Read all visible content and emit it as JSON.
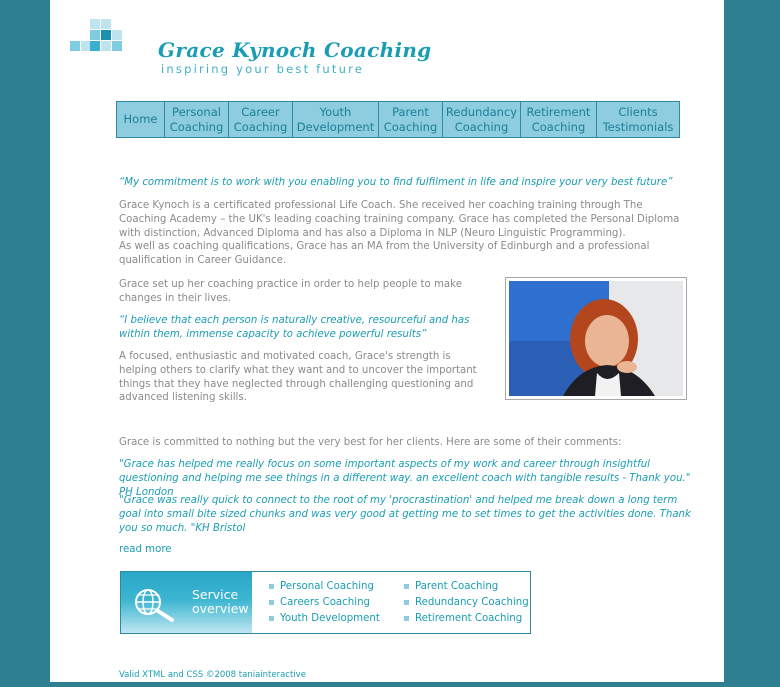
{
  "brand": {
    "name": "Grace Kynoch Coaching",
    "tagline": "inspiring your best future"
  },
  "nav": {
    "items": [
      {
        "label": "Home"
      },
      {
        "label": "Personal\nCoaching"
      },
      {
        "label": "Career\nCoaching"
      },
      {
        "label": "Youth\nDevelopment"
      },
      {
        "label": "Parent\nCoaching"
      },
      {
        "label": "Redundancy\nCoaching"
      },
      {
        "label": "Retirement\nCoaching"
      },
      {
        "label": "Clients\nTestimonials"
      }
    ]
  },
  "content": {
    "mission_quote": "“My commitment is to work with you enabling you to find fulfilment in life and inspire your very best future”",
    "intro_p1": "Grace Kynoch is a certificated professional Life Coach. She received her coaching training through The Coaching Academy – the UK's leading coaching training company. Grace has completed the Personal Diploma with distinction, Advanced Diploma and has also a Diploma in NLP (Neuro Linguistic Programming).",
    "intro_p2": "As well as coaching qualifications, Grace has an MA from the University of Edinburgh and a professional qualification in Career Guidance.",
    "setup_text": "Grace set up her coaching practice in order to help people to make changes in their lives.",
    "belief_quote": "“I believe that each person is naturally creative, resourceful and has within them, immense capacity to achieve powerful results”",
    "focus_text": "A focused, enthusiastic and motivated coach, Grace's strength is helping others to clarify what they want and to uncover the important things that they have neglected through challenging questioning and advanced listening skills.",
    "committed_text": "Grace is committed to nothing but the very best for her clients. Here are some of their comments:",
    "testimonial_1": "\"Grace has helped me really focus on some important aspects of my work and career through insightful questioning and helping me see things in a different way. an excellent coach with tangible results - Thank you.\" PH London",
    "testimonial_2": "\"Grace was really quick to connect to the root of my 'procrastination' and helped me break down a long term goal into small bite sized chunks and was very good at getting me to set times to get the activities done. Thank you so much. \"KH Bristol",
    "read_more": "read more"
  },
  "service_overview": {
    "title": "Service\noverview",
    "col1": [
      "Personal Coaching",
      "Careers Coaching",
      "Youth Development"
    ],
    "col2": [
      "Parent Coaching",
      "Redundancy Coaching",
      "Retirement Coaching"
    ]
  },
  "footer": {
    "text": "Valid XTML and CSS ©2008 taniainteractive"
  },
  "colors": {
    "background": "#2e7f91",
    "accent": "#1a9db3",
    "nav_bg": "#8ecde0",
    "body_text": "#8a8a8a"
  },
  "icons": {
    "service": "globe-magnifier-icon",
    "logo": "logo-squares-icon"
  }
}
